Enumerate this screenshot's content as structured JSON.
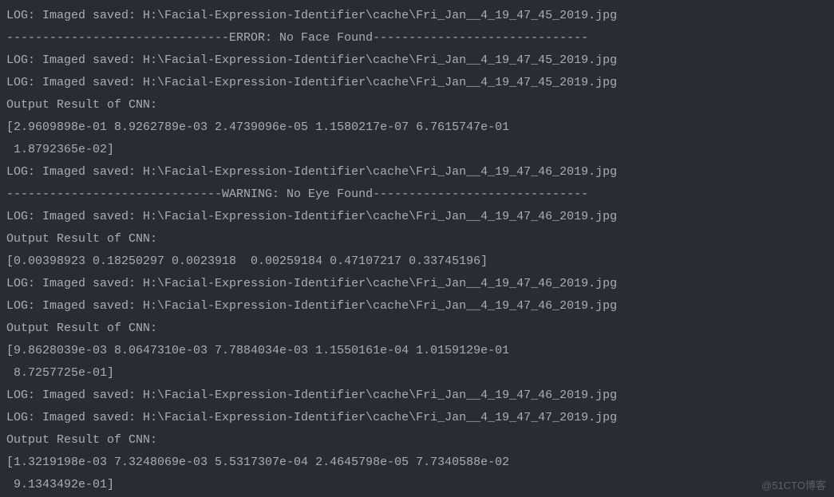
{
  "lines": [
    "LOG: Imaged saved: H:\\Facial-Expression-Identifier\\cache\\Fri_Jan__4_19_47_45_2019.jpg",
    "-------------------------------ERROR: No Face Found------------------------------",
    "LOG: Imaged saved: H:\\Facial-Expression-Identifier\\cache\\Fri_Jan__4_19_47_45_2019.jpg",
    "LOG: Imaged saved: H:\\Facial-Expression-Identifier\\cache\\Fri_Jan__4_19_47_45_2019.jpg",
    "Output Result of CNN:",
    "[2.9609898e-01 8.9262789e-03 2.4739096e-05 1.1580217e-07 6.7615747e-01",
    " 1.8792365e-02]",
    "LOG: Imaged saved: H:\\Facial-Expression-Identifier\\cache\\Fri_Jan__4_19_47_46_2019.jpg",
    "------------------------------WARNING: No Eye Found------------------------------",
    "LOG: Imaged saved: H:\\Facial-Expression-Identifier\\cache\\Fri_Jan__4_19_47_46_2019.jpg",
    "Output Result of CNN:",
    "[0.00398923 0.18250297 0.0023918  0.00259184 0.47107217 0.33745196]",
    "LOG: Imaged saved: H:\\Facial-Expression-Identifier\\cache\\Fri_Jan__4_19_47_46_2019.jpg",
    "LOG: Imaged saved: H:\\Facial-Expression-Identifier\\cache\\Fri_Jan__4_19_47_46_2019.jpg",
    "Output Result of CNN:",
    "[9.8628039e-03 8.0647310e-03 7.7884034e-03 1.1550161e-04 1.0159129e-01",
    " 8.7257725e-01]",
    "LOG: Imaged saved: H:\\Facial-Expression-Identifier\\cache\\Fri_Jan__4_19_47_46_2019.jpg",
    "LOG: Imaged saved: H:\\Facial-Expression-Identifier\\cache\\Fri_Jan__4_19_47_47_2019.jpg",
    "Output Result of CNN:",
    "[1.3219198e-03 7.3248069e-03 5.5317307e-04 2.4645798e-05 7.7340588e-02",
    " 9.1343492e-01]"
  ],
  "watermark": "@51CTO博客"
}
